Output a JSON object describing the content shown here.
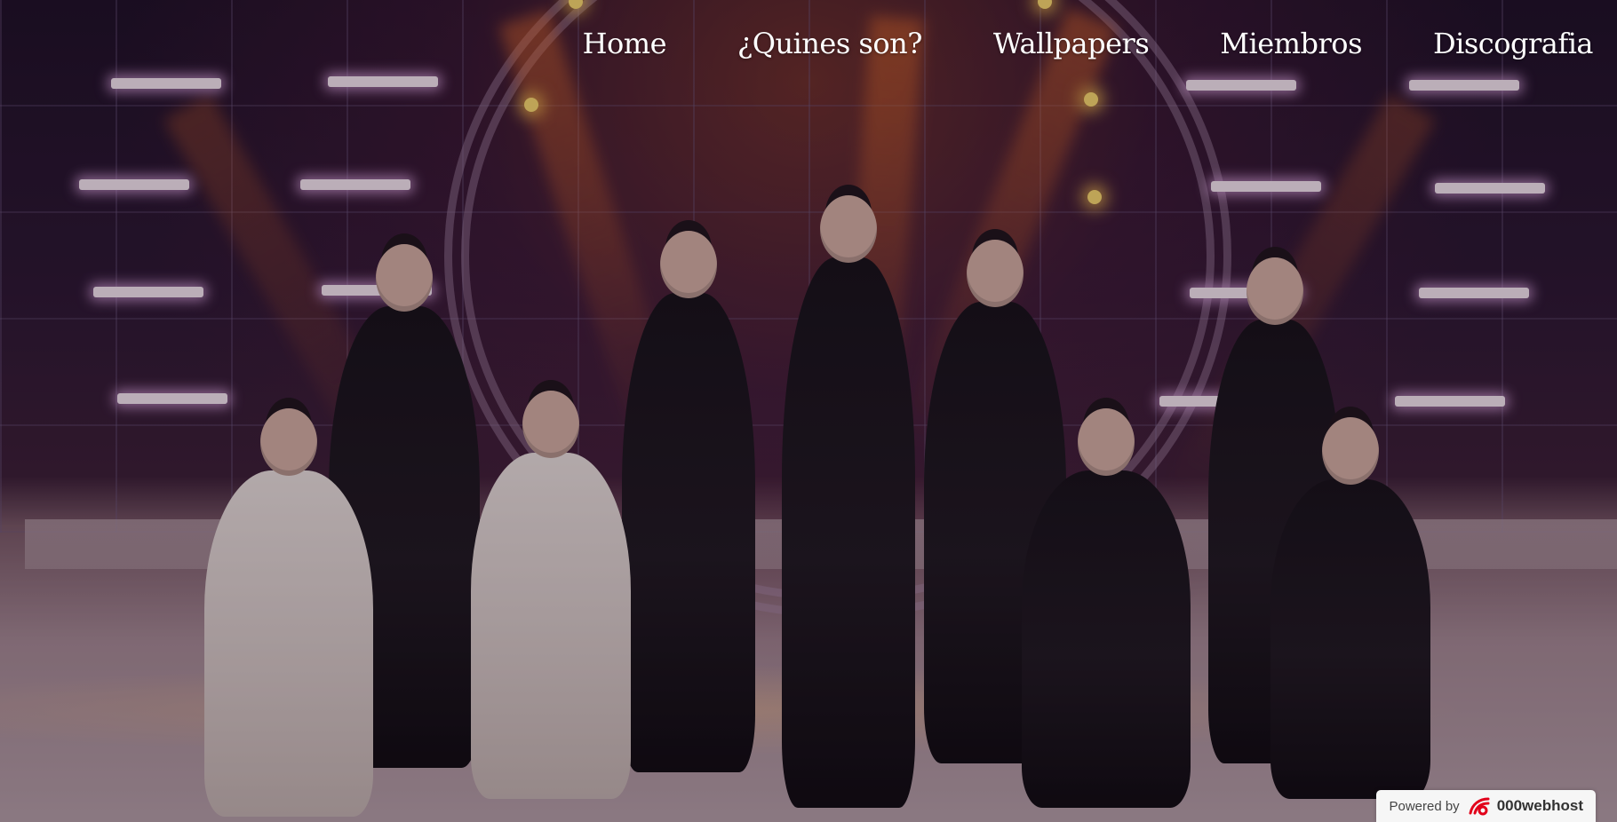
{
  "nav": {
    "items": [
      {
        "label": "Home"
      },
      {
        "label": "¿Quines son?"
      },
      {
        "label": "Wallpapers"
      },
      {
        "label": "Miembros"
      },
      {
        "label": "Discografia"
      }
    ]
  },
  "hero": {
    "image": "group-stage-performance-photo"
  },
  "badge": {
    "prefix": "Powered by",
    "brand": "000webhost",
    "icon": "000webhost-logo-icon",
    "brand_color": "#e2001a"
  }
}
